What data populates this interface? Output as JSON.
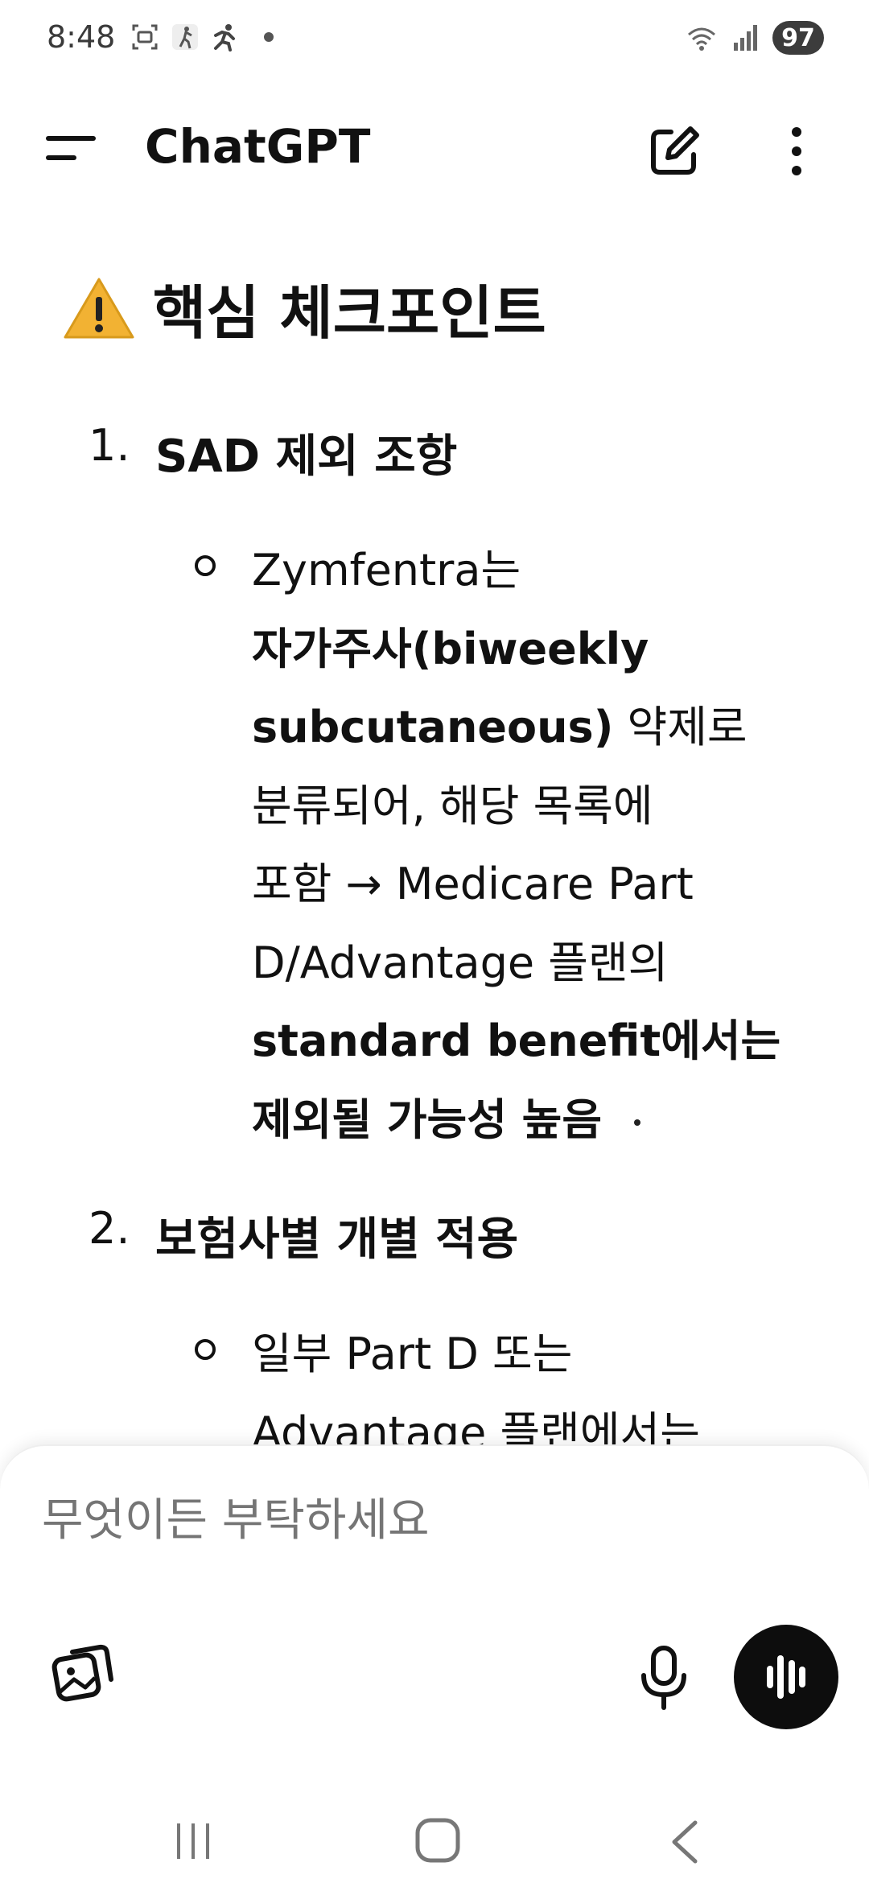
{
  "status_bar": {
    "time": "8:48",
    "battery": "97",
    "icons": [
      "screenshot-icon",
      "activity-icon",
      "running-icon",
      "wifi-icon",
      "signal-icon"
    ]
  },
  "app_bar": {
    "title": "ChatGPT",
    "icons": [
      "menu-icon",
      "new-chat-icon",
      "more-vert-icon"
    ]
  },
  "content": {
    "heading_icon": "warning-icon",
    "heading": "핵심 체크포인트",
    "items": [
      {
        "number": "1.",
        "title": "SAD 제외 조항",
        "bullet_lines": [
          [
            {
              "t": "Zymfentra는",
              "b": false
            }
          ],
          [
            {
              "t": "자가주사(biweekly",
              "b": true
            }
          ],
          [
            {
              "t": "subcutaneous)",
              "b": true
            },
            {
              "t": " 약제로",
              "b": false
            }
          ],
          [
            {
              "t": "분류되어, 해당 목록에",
              "b": false
            }
          ],
          [
            {
              "t": "포함 → Medicare Part",
              "b": false
            }
          ],
          [
            {
              "t": "D/Advantage 플랜의",
              "b": false
            }
          ],
          [
            {
              "t": "standard benefit에서는",
              "b": true
            }
          ],
          [
            {
              "t": "제외될 가능성 높음",
              "b": true
            }
          ]
        ],
        "ending": "."
      },
      {
        "number": "2.",
        "title": "보험사별 개별 적용",
        "bullet_lines": [
          [
            {
              "t": "일부 Part D 또는",
              "b": false
            }
          ],
          [
            {
              "t": "Advantage 플랜에서는",
              "b": false
            }
          ]
        ]
      }
    ]
  },
  "composer": {
    "placeholder": "무엇이든 부탁하세요",
    "icons": [
      "attach-image-icon",
      "microphone-icon",
      "voice-mode-icon"
    ]
  },
  "nav_bar": {
    "icons": [
      "recent-apps-icon",
      "home-icon",
      "back-icon"
    ]
  },
  "colors": {
    "text": "#0d0d0d",
    "placeholder": "#9b9b9b",
    "voice_button": "#0d0d0d",
    "warning": "#f2b233"
  }
}
